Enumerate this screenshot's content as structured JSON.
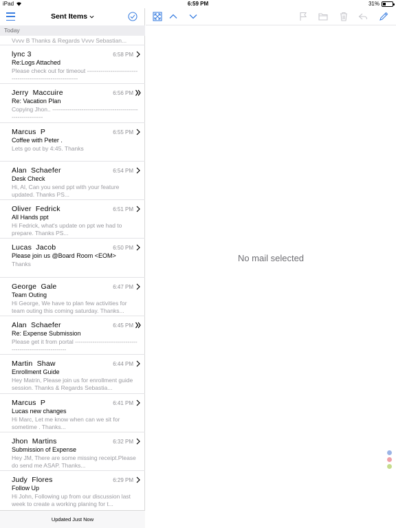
{
  "status_bar": {
    "device": "iPad",
    "time": "6:59 PM",
    "battery": "31%"
  },
  "nav": {
    "title": "Sent Items"
  },
  "section": {
    "label": "Today"
  },
  "list": {
    "partial_preview": "Vvvv B Thanks & Regards Vvvv Sebastian...",
    "items": [
      {
        "sender": "lync 3",
        "time": "6:58 PM",
        "subject": "Re:Logs Attached",
        "preview": "Please check out for timeout ------------------------------------------------------------",
        "arrow": "chevron"
      },
      {
        "sender": "Jerry  Maccuire",
        "time": "6:56 PM",
        "subject": "Re: Vacation Plan",
        "preview": "Copying Jhon.. ------------------------------------------------------------",
        "arrow": "double-chevron"
      },
      {
        "sender": "Marcus  P",
        "time": "6:55 PM",
        "subject": "Coffee with Peter .",
        "preview": "Lets go out by 4:45. Thanks",
        "arrow": "chevron"
      },
      {
        "sender": "Alan  Schaefer",
        "time": "6:54 PM",
        "subject": "Desk Check",
        "preview": "Hi, Al, Can you send ppt with your feature updated. Thanks PS...",
        "arrow": "chevron"
      },
      {
        "sender": "Oliver  Fedrick",
        "time": "6:51 PM",
        "subject": "All Hands ppt",
        "preview": "Hi Fedrick, what's update on ppt we had to prepare. Thanks PS...",
        "arrow": "chevron"
      },
      {
        "sender": "Lucas  Jacob",
        "time": "6:50 PM",
        "subject": "Please join us @Board Room <EOM>",
        "preview": "Thanks",
        "arrow": "chevron"
      },
      {
        "sender": "George  Gale",
        "time": "6:47 PM",
        "subject": "Team Outing",
        "preview": "Hi George, We have to plan few activities for team outing this coming saturday. Thanks...",
        "arrow": "chevron"
      },
      {
        "sender": "Alan  Schaefer",
        "time": "6:45 PM",
        "subject": "Re: Expense Submission",
        "preview": "Please get it from portal ------------------------------------------------------------",
        "arrow": "double-chevron"
      },
      {
        "sender": "Martin  Shaw",
        "time": "6:44 PM",
        "subject": "Enrollment Guide",
        "preview": "Hey Matrin, Please join us for enrollment guide session. Thanks & Regards Sebastia...",
        "arrow": "chevron"
      },
      {
        "sender": "Marcus  P",
        "time": "6:41 PM",
        "subject": "Lucas new changes",
        "preview": "Hi Marc, Let me know when can we sit for sometime . Thanks...",
        "arrow": "chevron"
      },
      {
        "sender": "Jhon  Martins",
        "time": "6:32 PM",
        "subject": "Submission of Expense",
        "preview": "Hey JM, There are some missing receipt.Please do send me ASAP. Thanks...",
        "arrow": "chevron"
      },
      {
        "sender": "Judy  Flores",
        "time": "6:29 PM",
        "subject": "Follow Up",
        "preview": "Hi John, Following up from our discussion last week to create a working planing for t...",
        "arrow": "chevron"
      }
    ]
  },
  "footer": {
    "status": "Updated Just Now"
  },
  "detail": {
    "empty_message": "No mail selected"
  },
  "icons": {
    "menu": "hamburger-icon",
    "select": "checkmark-circle-icon",
    "expand": "expand-icon",
    "previous": "chevron-up-icon",
    "next": "chevron-down-icon",
    "flag": "flag-icon",
    "move": "folder-icon",
    "delete": "trash-icon",
    "reply": "reply-icon",
    "compose": "pencil-icon"
  },
  "colors": {
    "accent": "#3a7ee0",
    "disabled": "#c7c7cc",
    "dot_blue": "#9cb4e6",
    "dot_red": "#f0a0a8",
    "dot_green": "#c6dc8c"
  }
}
